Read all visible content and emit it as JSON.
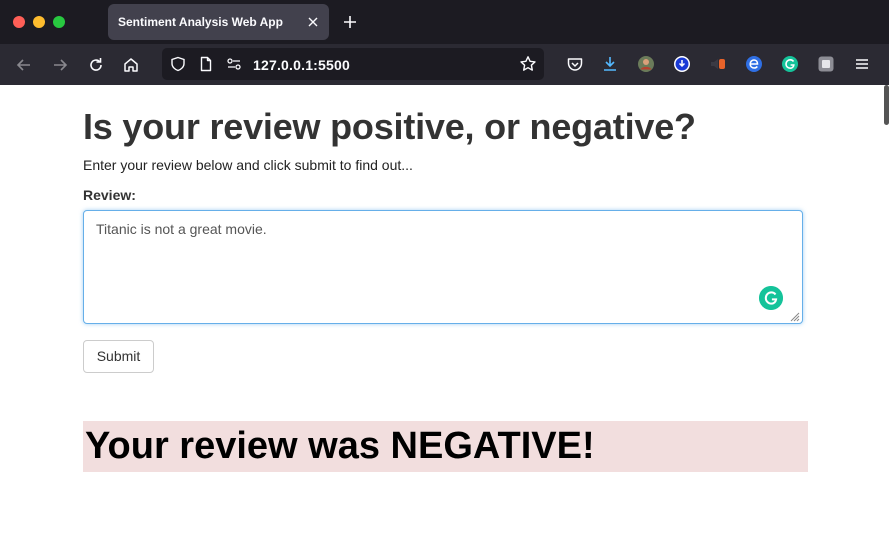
{
  "browser": {
    "tab_title": "Sentiment Analysis Web App",
    "url": "127.0.0.1:5500",
    "icons": {
      "close_tab": "close-icon",
      "new_tab": "plus-icon",
      "back": "arrow-left-icon",
      "forward": "arrow-right-icon",
      "reload": "reload-icon",
      "home": "home-icon",
      "shield": "shield-icon",
      "page": "page-icon",
      "permissions": "permissions-icon",
      "bookmark": "star-icon",
      "pocket": "pocket-icon",
      "downloads": "download-icon",
      "menu": "hamburger-menu-icon"
    },
    "extensions": [
      "avatar-extension-icon",
      "blue-download-extension-icon",
      "speaker-extension-icon",
      "e-extension-icon",
      "grammarly-extension-icon",
      "gray-extension-icon"
    ]
  },
  "page": {
    "heading": "Is your review positive, or negative?",
    "intro": "Enter your review below and click submit to find out...",
    "review_label": "Review:",
    "review_value": "Titanic is not a great movie.",
    "submit_label": "Submit",
    "result_text": "Your review was NEGATIVE!"
  },
  "colors": {
    "result_background": "#f2dede",
    "input_focus_border": "#66afe9",
    "grammarly": "#15c39a"
  }
}
